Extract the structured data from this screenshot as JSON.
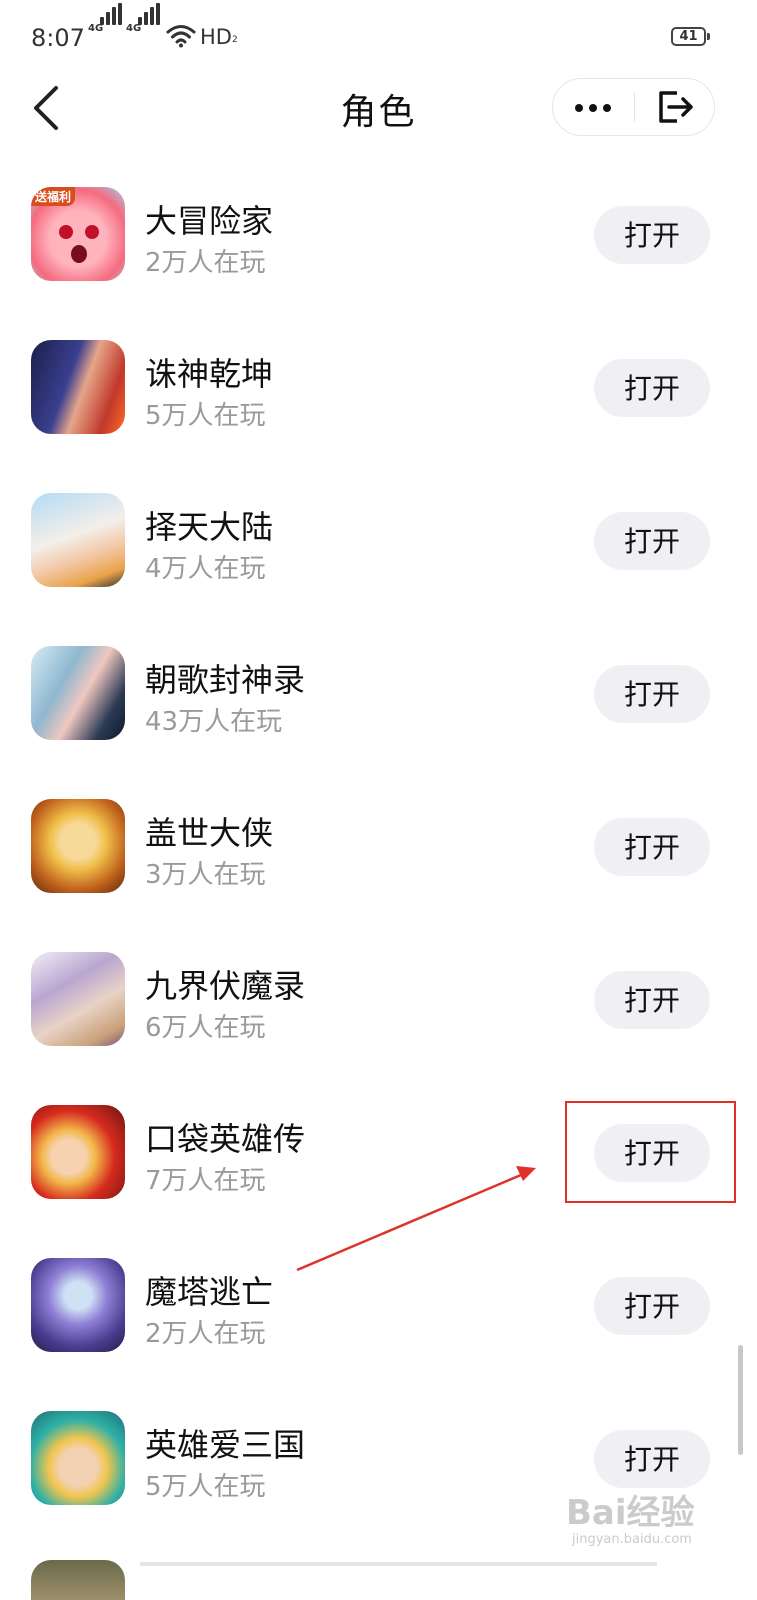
{
  "status_bar": {
    "time": "8:07",
    "network_1": "4G",
    "network_2": "4G",
    "hd_label": "HD",
    "hd_sub": "2",
    "battery": "41"
  },
  "nav": {
    "title": "角色",
    "back_icon": "chevron-left-icon",
    "more_icon": "more-dots-icon",
    "exit_icon": "exit-icon"
  },
  "games": [
    {
      "name": "大冒险家",
      "players": "2万人在玩",
      "button": "打开",
      "badge": "送福利",
      "icon_colors": [
        "#ff9aa8",
        "#f56a7e"
      ]
    },
    {
      "name": "诛神乾坤",
      "players": "5万人在玩",
      "button": "打开",
      "icon_colors": [
        "#1b1f4a",
        "#c0392b"
      ]
    },
    {
      "name": "择天大陆",
      "players": "4万人在玩",
      "button": "打开",
      "icon_colors": [
        "#eaa24a",
        "#f3efe9"
      ]
    },
    {
      "name": "朝歌封神录",
      "players": "43万人在玩",
      "button": "打开",
      "icon_colors": [
        "#8fb7cf",
        "#2b3a55"
      ]
    },
    {
      "name": "盖世大侠",
      "players": "3万人在玩",
      "button": "打开",
      "icon_colors": [
        "#c0601c",
        "#f0c04a"
      ]
    },
    {
      "name": "九界伏魔录",
      "players": "6万人在玩",
      "button": "打开",
      "icon_colors": [
        "#b9a6d0",
        "#e8d3c6"
      ]
    },
    {
      "name": "口袋英雄传",
      "players": "7万人在玩",
      "button": "打开",
      "icon_colors": [
        "#d62a1e",
        "#f2b84b"
      ]
    },
    {
      "name": "魔塔逃亡",
      "players": "2万人在玩",
      "button": "打开",
      "icon_colors": [
        "#4a3d8f",
        "#8f7fd6"
      ]
    },
    {
      "name": "英雄爱三国",
      "players": "5万人在玩",
      "button": "打开",
      "icon_colors": [
        "#2fb0a6",
        "#f0c54e"
      ]
    }
  ],
  "watermark": {
    "text": "Bai经验",
    "sub": "jingyan.baidu.com"
  },
  "colors": {
    "button_bg": "#f0f0f4",
    "annotation_red": "#e0312b",
    "secondary_text": "#9a9a9a"
  }
}
